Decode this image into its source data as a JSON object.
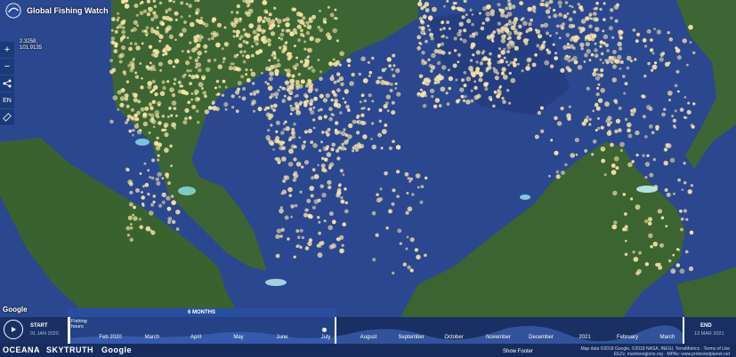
{
  "header": {
    "title": "Global Fishing Watch"
  },
  "coords": {
    "lat": "2.3258,",
    "lon": "101.9135"
  },
  "controls": {
    "zoom_in": "+",
    "zoom_out": "−",
    "language": "EN"
  },
  "map": {
    "google_watermark": "Google"
  },
  "timebar": {
    "start_label": "START",
    "start_date": "01 JAN 2020",
    "end_label": "END",
    "end_date": "13 MAR 2021",
    "range_label": "6 MONTHS",
    "fishing_hours": "Fishing hours",
    "months": [
      "Feb 2020",
      "March",
      "April",
      "May",
      "June",
      "July",
      "August",
      "September",
      "October",
      "November",
      "December",
      "2021",
      "February",
      "March"
    ]
  },
  "attribution": {
    "line1": "Map data ©2018 Google, ©2018 NASA, INEGI, TerraMetrics · Terms of Use",
    "line2": "EEZs: marineregions.org · MPAs: www.protectedplanet.net"
  },
  "footer": {
    "brands": [
      "OCEANA",
      "SKYTRUTH",
      "Google"
    ],
    "show_footer": "Show Footer"
  },
  "colors": {
    "ocean": "#2a4690",
    "land": "#3c6432",
    "fishing": "#f6e3a6",
    "timebar": "#1a3064"
  }
}
